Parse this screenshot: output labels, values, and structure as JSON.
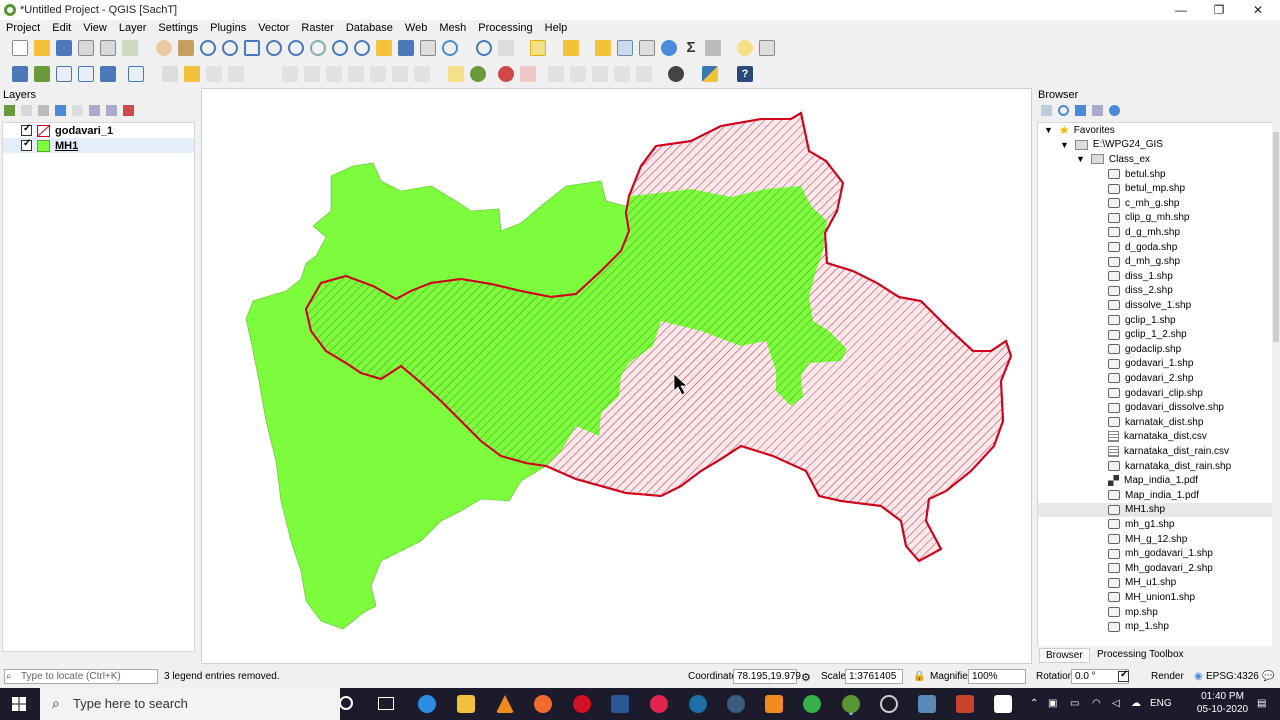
{
  "window": {
    "title": "*Untitled Project - QGIS [SachT]",
    "minimize": "—",
    "maximize": "❐",
    "close": "✕"
  },
  "menu": [
    "Project",
    "Edit",
    "View",
    "Layer",
    "Settings",
    "Plugins",
    "Vector",
    "Raster",
    "Database",
    "Web",
    "Mesh",
    "Processing",
    "Help"
  ],
  "layers_panel": {
    "title": "Layers",
    "layers": [
      {
        "name": "godavari_1",
        "checked": true,
        "swatch": "hatched-red"
      },
      {
        "name": "MH1",
        "checked": true,
        "swatch": "#7cfc3c"
      }
    ]
  },
  "browser_panel": {
    "title": "Browser",
    "favorites": "Favorites",
    "drive": "E:\\WPG24_GIS",
    "folder": "Class_ex",
    "files": [
      {
        "name": "betul.shp",
        "type": "vector"
      },
      {
        "name": "betul_mp.shp",
        "type": "vector"
      },
      {
        "name": "c_mh_g.shp",
        "type": "vector"
      },
      {
        "name": "clip_g_mh.shp",
        "type": "vector"
      },
      {
        "name": "d_g_mh.shp",
        "type": "vector"
      },
      {
        "name": "d_goda.shp",
        "type": "vector"
      },
      {
        "name": "d_mh_g.shp",
        "type": "vector"
      },
      {
        "name": "diss_1.shp",
        "type": "vector"
      },
      {
        "name": "diss_2.shp",
        "type": "vector"
      },
      {
        "name": "dissolve_1.shp",
        "type": "vector"
      },
      {
        "name": "gclip_1.shp",
        "type": "vector"
      },
      {
        "name": "gclip_1_2.shp",
        "type": "vector"
      },
      {
        "name": "godaclip.shp",
        "type": "vector"
      },
      {
        "name": "godavari_1.shp",
        "type": "vector"
      },
      {
        "name": "godavari_2.shp",
        "type": "vector"
      },
      {
        "name": "godavari_clip.shp",
        "type": "vector"
      },
      {
        "name": "godavari_dissolve.shp",
        "type": "vector"
      },
      {
        "name": "karnatak_dist.shp",
        "type": "vector"
      },
      {
        "name": "karnataka_dist.csv",
        "type": "table"
      },
      {
        "name": "karnataka_dist_rain.csv",
        "type": "table"
      },
      {
        "name": "karnataka_dist_rain.shp",
        "type": "vector"
      },
      {
        "name": "Map_india_1.pdf",
        "type": "pdf"
      },
      {
        "name": "Map_india_1.pdf",
        "type": "vector"
      },
      {
        "name": "MH1.shp",
        "type": "vector",
        "selected": true
      },
      {
        "name": "mh_g1.shp",
        "type": "vector"
      },
      {
        "name": "MH_g_12.shp",
        "type": "vector"
      },
      {
        "name": "mh_godavari_1.shp",
        "type": "vector"
      },
      {
        "name": "Mh_godavari_2.shp",
        "type": "vector"
      },
      {
        "name": "MH_u1.shp",
        "type": "vector"
      },
      {
        "name": "MH_union1.shp",
        "type": "vector"
      },
      {
        "name": "mp.shp",
        "type": "vector"
      },
      {
        "name": "mp_1.shp",
        "type": "vector"
      }
    ],
    "tabs": [
      "Browser",
      "Processing Toolbox"
    ]
  },
  "colors": {
    "mh_fill": "#7cfc3c",
    "godavari_stroke": "#d0021b",
    "accent": "#3b8ad8"
  },
  "status": {
    "locate_placeholder": "Type to locate (Ctrl+K)",
    "message": "3 legend entries removed.",
    "coordinate_label": "Coordinate",
    "coordinate": "78.195,19.979",
    "scale_label": "Scale",
    "scale": "1:3761405",
    "magnifier_label": "Magnifier",
    "magnifier": "100%",
    "rotation_label": "Rotation",
    "rotation": "0.0 °",
    "render_label": "Render",
    "crs": "EPSG:4326"
  },
  "taskbar": {
    "search_placeholder": "Type here to search",
    "lang": "ENG",
    "time": "01:40 PM",
    "date": "05-10-2020"
  }
}
